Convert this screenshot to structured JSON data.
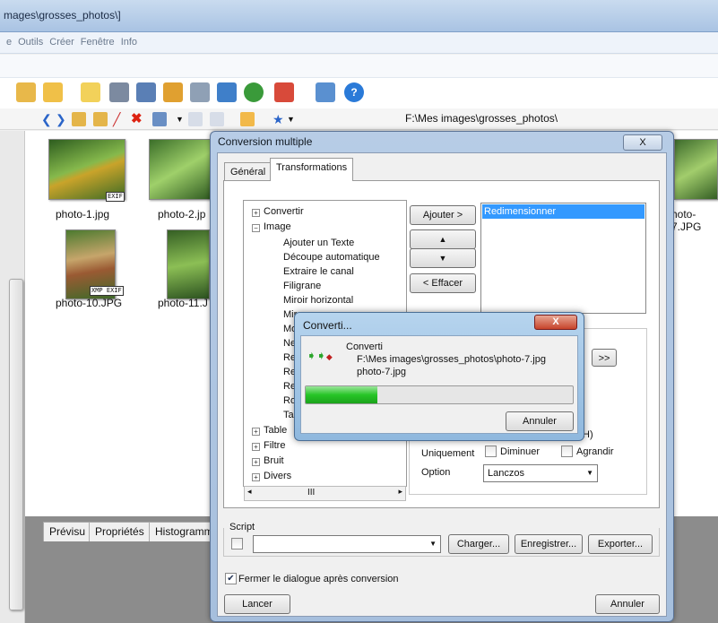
{
  "window": {
    "title": "mages\\grosses_photos\\]"
  },
  "menu": {
    "items": [
      "e",
      "Outils",
      "Créer",
      "Fenêtre",
      "Info"
    ]
  },
  "address": {
    "path": "F:\\Mes images\\grosses_photos\\"
  },
  "thumbnails": [
    {
      "label": "photo-1.jpg",
      "badges": "EXIF"
    },
    {
      "label": "photo-2.jp",
      "badges": ""
    },
    {
      "label": "hoto-7.JPG",
      "badges": ""
    },
    {
      "label": "photo-10.JPG",
      "badges": "XMP EXIF"
    },
    {
      "label": "photo-11.J",
      "badges": ""
    }
  ],
  "bottom_tabs": [
    "Prévisu",
    "Propriétés",
    "Histogramm"
  ],
  "dialog": {
    "title": "Conversion multiple",
    "close_label": "X",
    "tabs": [
      "Général",
      "Transformations"
    ],
    "tree": {
      "convertir": "Convertir",
      "image": "Image",
      "children": [
        "Ajouter un Texte",
        "Découpe automatique",
        "Extraire le canal",
        "Filigrane",
        "Miroir horizontal",
        "Mir",
        "Mo",
        "Ne",
        "Re",
        "Re",
        "Re",
        "Ro",
        "Ta"
      ],
      "table": "Table",
      "filtre": "Filtre",
      "bruit": "Bruit",
      "divers": "Divers",
      "scroll_thumb": "III"
    },
    "add_button": "Ajouter >",
    "up_arrow": "▲",
    "down_arrow": "▼",
    "clear_button": "< Effacer",
    "list_selected": "Redimensionner",
    "more_button": ">>",
    "partial_paren": "H)",
    "uniquement_label": "Uniquement",
    "diminuer_label": "Diminuer",
    "agrandir_label": "Agrandir",
    "option_label": "Option",
    "option_value": "Lanczos",
    "script_label": "Script",
    "load_button": "Charger...",
    "save_button": "Enregistrer...",
    "export_button": "Exporter...",
    "close_after_label": "Fermer le dialogue après conversion",
    "launch_button": "Lancer",
    "cancel_button": "Annuler"
  },
  "progress": {
    "title": "Converti...",
    "close_label": "X",
    "heading": "Converti",
    "path": "F:\\Mes images\\grosses_photos\\photo-7.jpg",
    "file": "photo-7.jpg",
    "fraction": 0.27,
    "cancel": "Annuler"
  }
}
